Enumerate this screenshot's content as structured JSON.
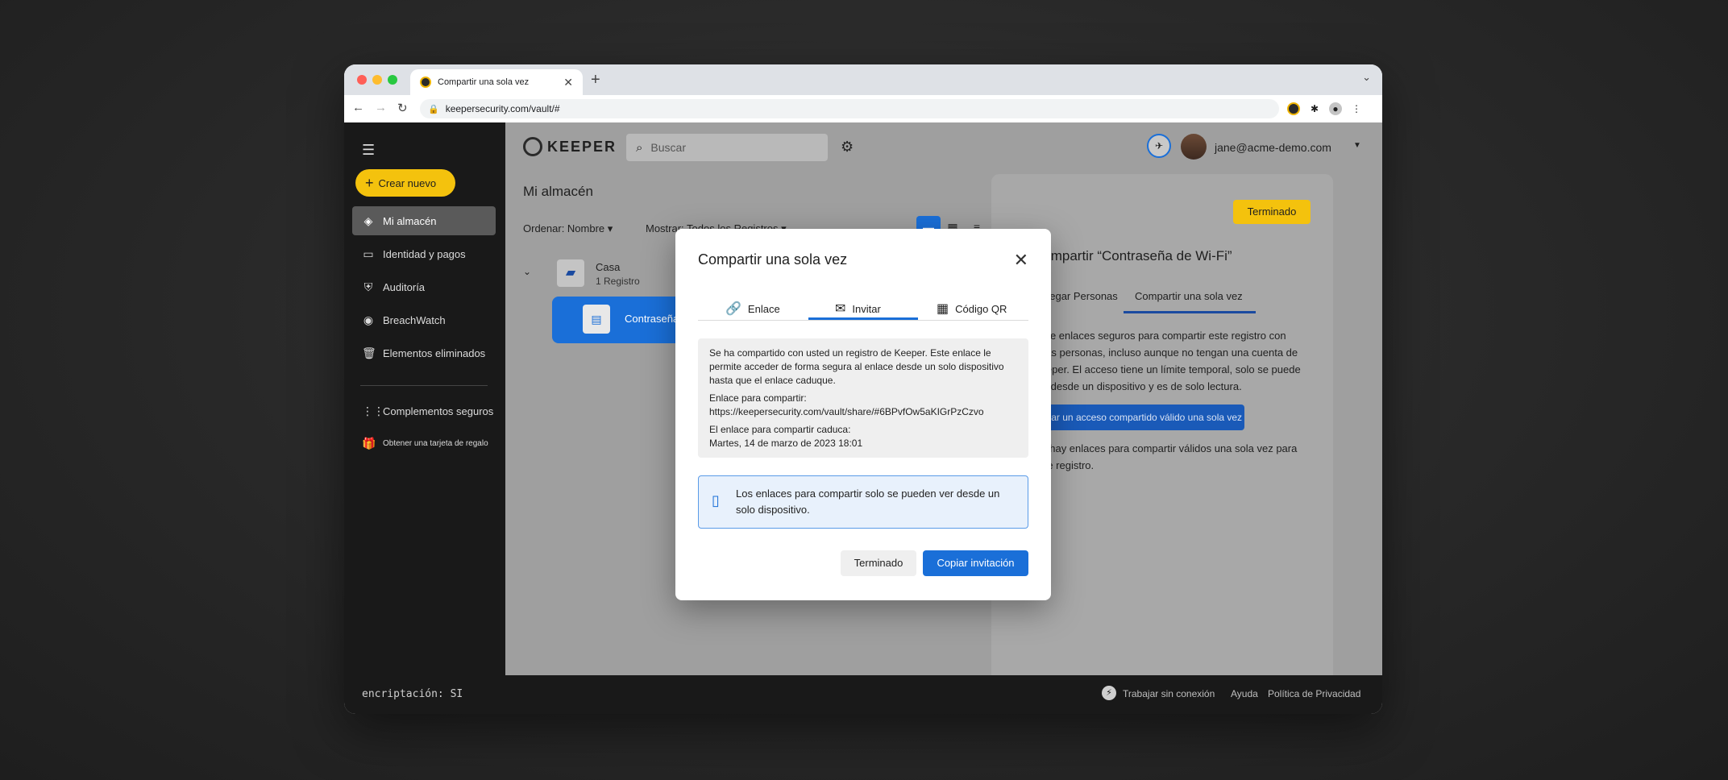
{
  "browser": {
    "tab_title": "Compartir una sola vez",
    "url": "keepersecurity.com/vault/#"
  },
  "sidebar": {
    "create_label": "Crear nuevo",
    "items": [
      {
        "label": "Mi almacén",
        "icon": "vault-icon"
      },
      {
        "label": "Identidad y pagos",
        "icon": "card-icon"
      },
      {
        "label": "Auditoría",
        "icon": "shield-icon"
      },
      {
        "label": "BreachWatch",
        "icon": "breachwatch-icon"
      },
      {
        "label": "Elementos eliminados",
        "icon": "trash-icon"
      },
      {
        "label": "Complementos seguros",
        "icon": "grid-icon"
      },
      {
        "label": "Obtener una tarjeta de regalo",
        "icon": "gift-icon"
      }
    ]
  },
  "header": {
    "logo_text": "KEEPER",
    "search_placeholder": "Buscar",
    "account": "jane@acme-demo.com"
  },
  "vault": {
    "title": "Mi almacén",
    "sort_label": "Ordenar: Nombre",
    "show_label": "Mostrar: Todos los Registros",
    "folder_name": "Casa",
    "folder_count": "1 Registro",
    "record_name": "Contraseña de Wi-Fi"
  },
  "panel": {
    "done_label": "Terminado",
    "title": "Compartir “Contraseña de Wi-Fi”",
    "tab_people": "Agregar Personas",
    "tab_onetime": "Compartir una sola vez",
    "description": "Cree enlaces seguros para compartir este registro con otras personas, incluso aunque no tengan una cuenta de Keeper. El acceso tiene un límite temporal, solo se puede ver desde un dispositivo y es de solo lectura.",
    "create_button": "Crear un acceso compartido válido una sola vez",
    "note": "No hay enlaces para compartir válidos una sola vez para este registro."
  },
  "modal": {
    "title": "Compartir una sola vez",
    "tabs": [
      {
        "label": "Enlace",
        "icon": "link-icon"
      },
      {
        "label": "Invitar",
        "icon": "mail-icon"
      },
      {
        "label": "Código QR",
        "icon": "qr-code-icon"
      }
    ],
    "active_tab": "Invitar",
    "message": "Se ha compartido con usted un registro de Keeper. Este enlace le permite acceder de forma segura al enlace desde un solo dispositivo hasta que el enlace caduque.",
    "link_label": "Enlace para compartir:",
    "link_url": "https://keepersecurity.com/vault/share/#6BPvfOw5aKIGrPzCzvo",
    "expires_label": "El enlace para compartir caduca:",
    "expires_date": "Martes, 14 de marzo de 2023 18:01",
    "info_text": "Los enlaces para compartir solo se pueden ver desde un solo dispositivo.",
    "done_label": "Terminado",
    "copy_label": "Copiar invitación"
  },
  "footer": {
    "encryption": "encriptación: SI",
    "offline": "Trabajar sin conexión",
    "help": "Ayuda",
    "privacy": "Política de Privacidad"
  },
  "colors": {
    "accent_yellow": "#f4c20d",
    "accent_blue": "#1a6fd8",
    "sidebar_bg": "#191919"
  }
}
